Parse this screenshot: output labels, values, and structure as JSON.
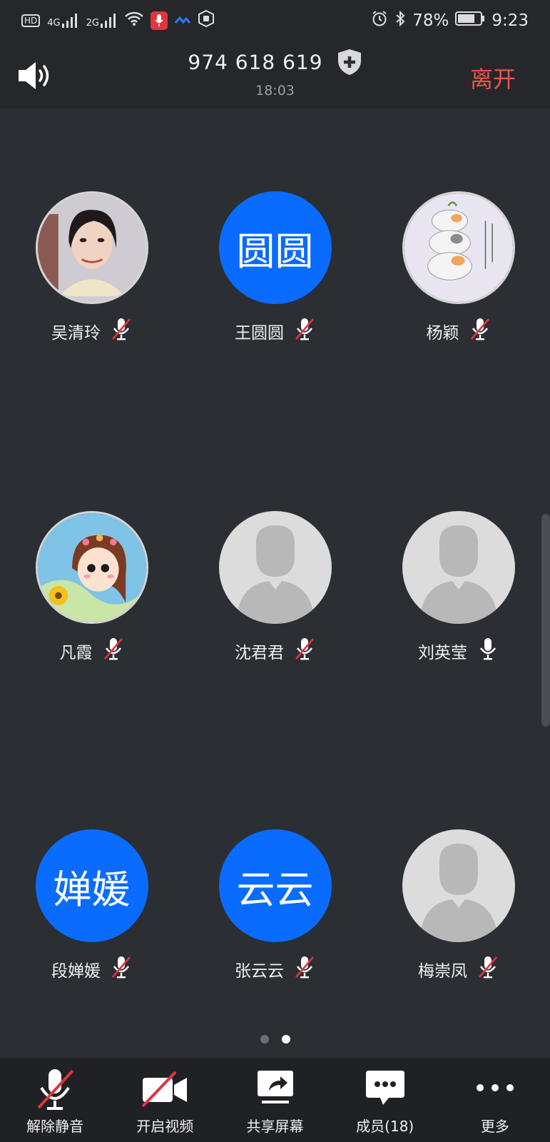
{
  "status_bar": {
    "left_icons": [
      "hd-icon",
      "signal-4g-icon",
      "signal-2g-icon",
      "wifi-icon",
      "recording-icon",
      "app-icon",
      "gesture-icon"
    ],
    "net1": "4G",
    "net2": "2G",
    "hd": "HD",
    "battery": "78%",
    "time": "9:23"
  },
  "header": {
    "meeting_id": "974 618 619",
    "elapsed": "18:03",
    "leave_label": "离开"
  },
  "participants": [
    {
      "name": "吴清玲",
      "avatar_type": "photo",
      "muted": true
    },
    {
      "name": "王圆圆",
      "avatar_type": "initials",
      "initials": "圆圆",
      "muted": true
    },
    {
      "name": "杨颖",
      "avatar_type": "photo",
      "muted": true
    },
    {
      "name": "凡霞",
      "avatar_type": "photo",
      "muted": true
    },
    {
      "name": "沈君君",
      "avatar_type": "default",
      "muted": true
    },
    {
      "name": "刘英莹",
      "avatar_type": "default",
      "muted": false
    },
    {
      "name": "段婵媛",
      "avatar_type": "initials",
      "initials": "婵媛",
      "muted": true
    },
    {
      "name": "张云云",
      "avatar_type": "initials",
      "initials": "云云",
      "muted": true
    },
    {
      "name": "梅崇凤",
      "avatar_type": "default",
      "muted": true
    }
  ],
  "pager": {
    "pages": 2,
    "current": 2
  },
  "toolbar": {
    "unmute": "解除静音",
    "start_video": "开启视频",
    "share_screen": "共享屏幕",
    "members": "成员(18)",
    "more": "更多"
  },
  "colors": {
    "background": "#2b2e33",
    "header": "#25272b",
    "toolbar": "#1f2125",
    "accent_blue": "#0a6cff",
    "leave_red": "#f0524f",
    "mute_red": "#e0353d"
  }
}
